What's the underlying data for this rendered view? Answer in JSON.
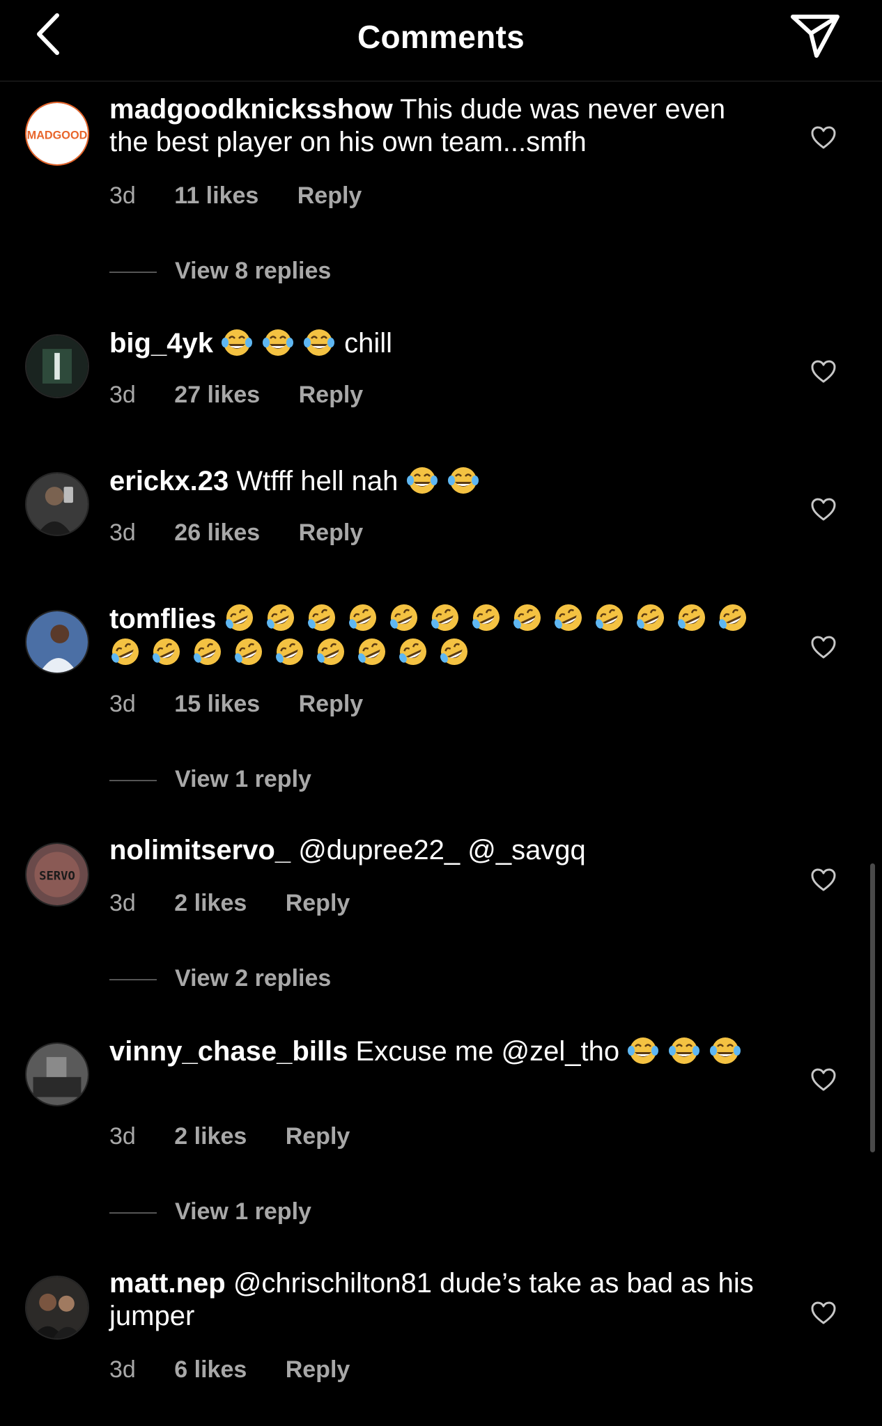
{
  "header": {
    "title": "Comments",
    "back_icon": "chevron-left-icon",
    "share_icon": "paper-plane-icon"
  },
  "comments": [
    {
      "username": "madgoodknicksshow",
      "text": "This dude was never even the best player on his own team...smfh",
      "time": "3d",
      "likes": "11 likes",
      "reply": "Reply",
      "view_replies": "View 8 replies",
      "avatar_text": "MADGOOD"
    },
    {
      "username": "big_4yk",
      "text": "chill",
      "emoji_before_text": 3,
      "time": "3d",
      "likes": "27 likes",
      "reply": "Reply"
    },
    {
      "username": "erickx.23",
      "text": "Wtfff hell nah",
      "emoji_after_text": 2,
      "time": "3d",
      "likes": "26 likes",
      "reply": "Reply"
    },
    {
      "username": "tomflies",
      "text": "",
      "emoji_rofl": 22,
      "time": "3d",
      "likes": "15 likes",
      "reply": "Reply",
      "view_replies": "View 1 reply"
    },
    {
      "username": "nolimitservo_",
      "text": "@dupree22_ @_savgq",
      "time": "3d",
      "likes": "2 likes",
      "reply": "Reply",
      "view_replies": "View 2 replies",
      "avatar_text": "SERVO"
    },
    {
      "username": "vinny_chase_bills",
      "text": "Excuse me @zel_tho",
      "emoji_after_text": 3,
      "time": "3d",
      "likes": "2 likes",
      "reply": "Reply",
      "view_replies": "View 1 reply"
    },
    {
      "username": "matt.nep",
      "text": "@chrischilton81 dude’s take as bad as his jumper",
      "time": "3d",
      "likes": "6 likes",
      "reply": "Reply"
    }
  ],
  "colors": {
    "background": "#000000",
    "text": "#ffffff",
    "secondary_text": "#a8a8a8",
    "emoji": "#f4c242"
  }
}
